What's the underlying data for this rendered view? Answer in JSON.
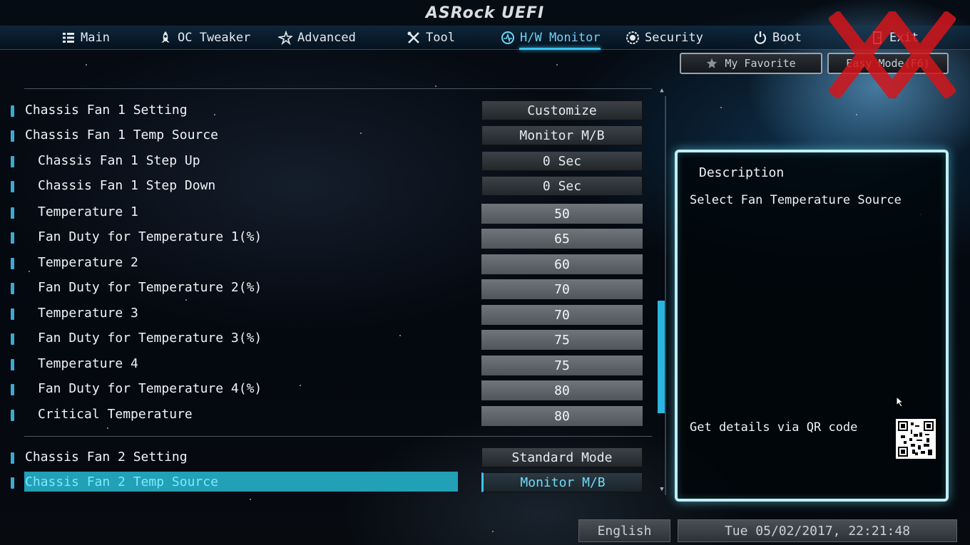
{
  "brand": {
    "logo_text": "ASRock UEFI"
  },
  "tabs": [
    {
      "label": "Main",
      "icon": "list-icon",
      "active": false
    },
    {
      "label": "OC Tweaker",
      "icon": "rocket-icon",
      "active": false
    },
    {
      "label": "Advanced",
      "icon": "star-icon",
      "active": false
    },
    {
      "label": "Tool",
      "icon": "tools-icon",
      "active": false
    },
    {
      "label": "H/W Monitor",
      "icon": "monitor-gauge-icon",
      "active": true
    },
    {
      "label": "Security",
      "icon": "shield-icon",
      "active": false
    },
    {
      "label": "Boot",
      "icon": "power-icon",
      "active": false
    },
    {
      "label": "Exit",
      "icon": "exit-door-icon",
      "active": false
    }
  ],
  "mode_buttons": {
    "favorite": "My Favorite",
    "easy_mode": "Easy Mode(F6)"
  },
  "settings": [
    {
      "label": "Chassis Fan 1 Setting",
      "value": "Customize",
      "indent": 1,
      "value_style": "btn"
    },
    {
      "label": "Chassis Fan 1 Temp Source",
      "value": "Monitor M/B",
      "indent": 1,
      "value_style": "btn"
    },
    {
      "label": "Chassis Fan 1 Step Up",
      "value": "0 Sec",
      "indent": 2,
      "value_style": "btn"
    },
    {
      "label": "Chassis Fan 1 Step Down",
      "value": "0 Sec",
      "indent": 2,
      "value_style": "btn"
    },
    {
      "label": "Temperature 1",
      "value": "50",
      "indent": 2,
      "value_style": "num"
    },
    {
      "label": "Fan Duty for Temperature 1(%)",
      "value": "65",
      "indent": 2,
      "value_style": "num"
    },
    {
      "label": "Temperature 2",
      "value": "60",
      "indent": 2,
      "value_style": "num"
    },
    {
      "label": "Fan Duty for Temperature 2(%)",
      "value": "70",
      "indent": 2,
      "value_style": "num"
    },
    {
      "label": "Temperature 3",
      "value": "70",
      "indent": 2,
      "value_style": "num"
    },
    {
      "label": "Fan Duty for Temperature 3(%)",
      "value": "75",
      "indent": 2,
      "value_style": "num"
    },
    {
      "label": "Temperature 4",
      "value": "75",
      "indent": 2,
      "value_style": "num"
    },
    {
      "label": "Fan Duty for Temperature 4(%)",
      "value": "80",
      "indent": 2,
      "value_style": "num"
    },
    {
      "label": "Critical Temperature",
      "value": "80",
      "indent": 2,
      "value_style": "num"
    },
    {
      "label": "Chassis Fan 2 Setting",
      "value": "Standard Mode",
      "indent": 1,
      "value_style": "btn"
    },
    {
      "label": "Chassis Fan 2 Temp Source",
      "value": "Monitor M/B",
      "indent": 1,
      "value_style": "btn",
      "selected": true
    }
  ],
  "description": {
    "title": "Description",
    "text": "Select Fan Temperature Source",
    "qr_text": "Get details via QR code"
  },
  "footer": {
    "language": "English",
    "datetime": "Tue 05/02/2017, 22:21:48"
  },
  "colors": {
    "accent": "#3ec3ef",
    "selected_row": "#21a0b6",
    "panel_border": "#bfeef6",
    "watermark": "#d4151a"
  }
}
